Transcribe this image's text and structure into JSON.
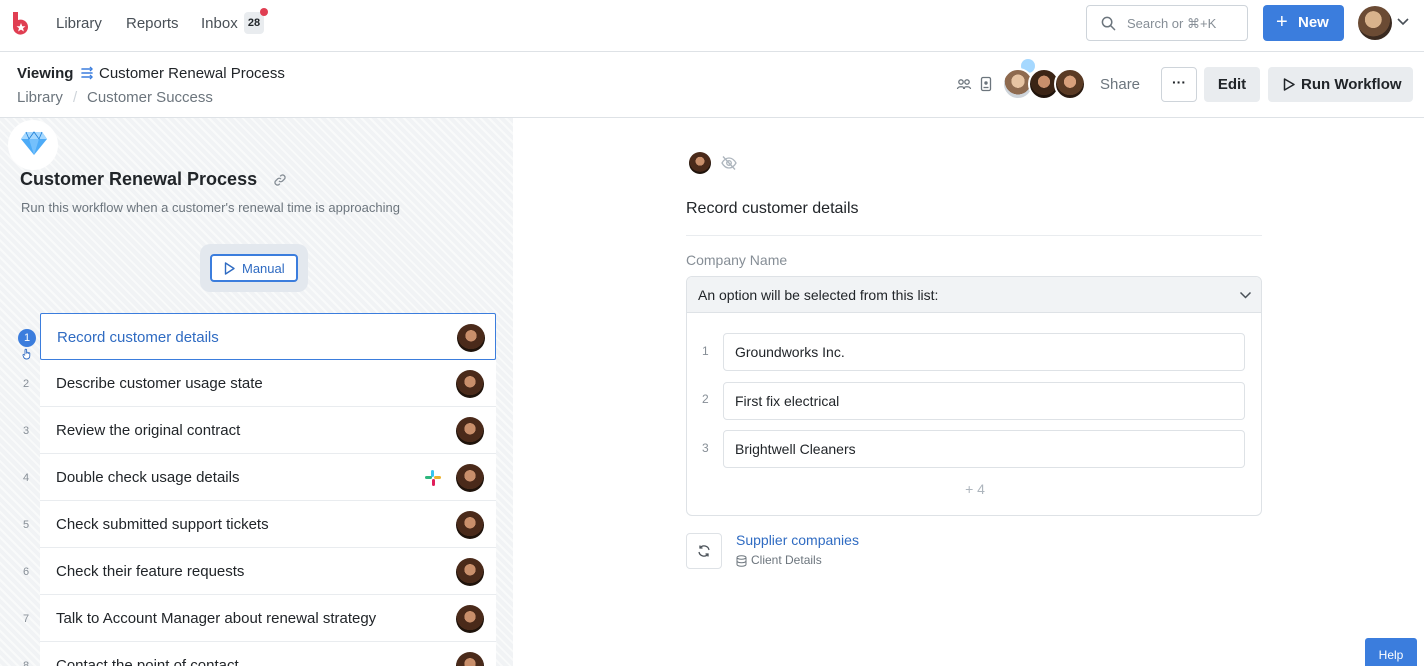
{
  "nav": {
    "links": [
      "Library",
      "Reports",
      "Inbox"
    ],
    "inbox_count": "28",
    "search_placeholder": "Search or ⌘+K",
    "new_label": "New"
  },
  "header": {
    "viewing_label": "Viewing",
    "workflow_title": "Customer Renewal Process",
    "breadcrumb": [
      "Library",
      "Customer Success"
    ],
    "breadcrumb_separator": "/",
    "share_label": "Share",
    "more_label": "···",
    "edit_label": "Edit",
    "run_label": "Run Workflow"
  },
  "workflow": {
    "title": "Customer Renewal Process",
    "description": "Run this workflow when a customer's renewal time is approaching",
    "trigger_label": "Manual",
    "tasks": [
      {
        "num": "1",
        "label": "Record customer details",
        "active": true
      },
      {
        "num": "2",
        "label": "Describe customer usage state"
      },
      {
        "num": "3",
        "label": "Review the original contract"
      },
      {
        "num": "4",
        "label": "Double check usage details",
        "integration": "slack-icon"
      },
      {
        "num": "5",
        "label": "Check submitted support tickets"
      },
      {
        "num": "6",
        "label": "Check their feature requests"
      },
      {
        "num": "7",
        "label": "Talk to Account Manager about renewal strategy"
      },
      {
        "num": "8",
        "label": "Contact the point of contact"
      }
    ]
  },
  "task_detail": {
    "title": "Record customer details",
    "field_label": "Company Name",
    "dropdown_hint": "An option will be selected from this list:",
    "options": [
      {
        "num": "1",
        "value": "Groundworks Inc."
      },
      {
        "num": "2",
        "value": "First fix electrical"
      },
      {
        "num": "3",
        "value": "Brightwell Cleaners"
      }
    ],
    "more_options": "+ 4",
    "source_link": "Supplier companies",
    "source_sub": "Client Details"
  },
  "help_label": "Help",
  "colors": {
    "accent": "#3b7ddd",
    "brand": "#e03e52",
    "link": "#2f6bc2"
  }
}
